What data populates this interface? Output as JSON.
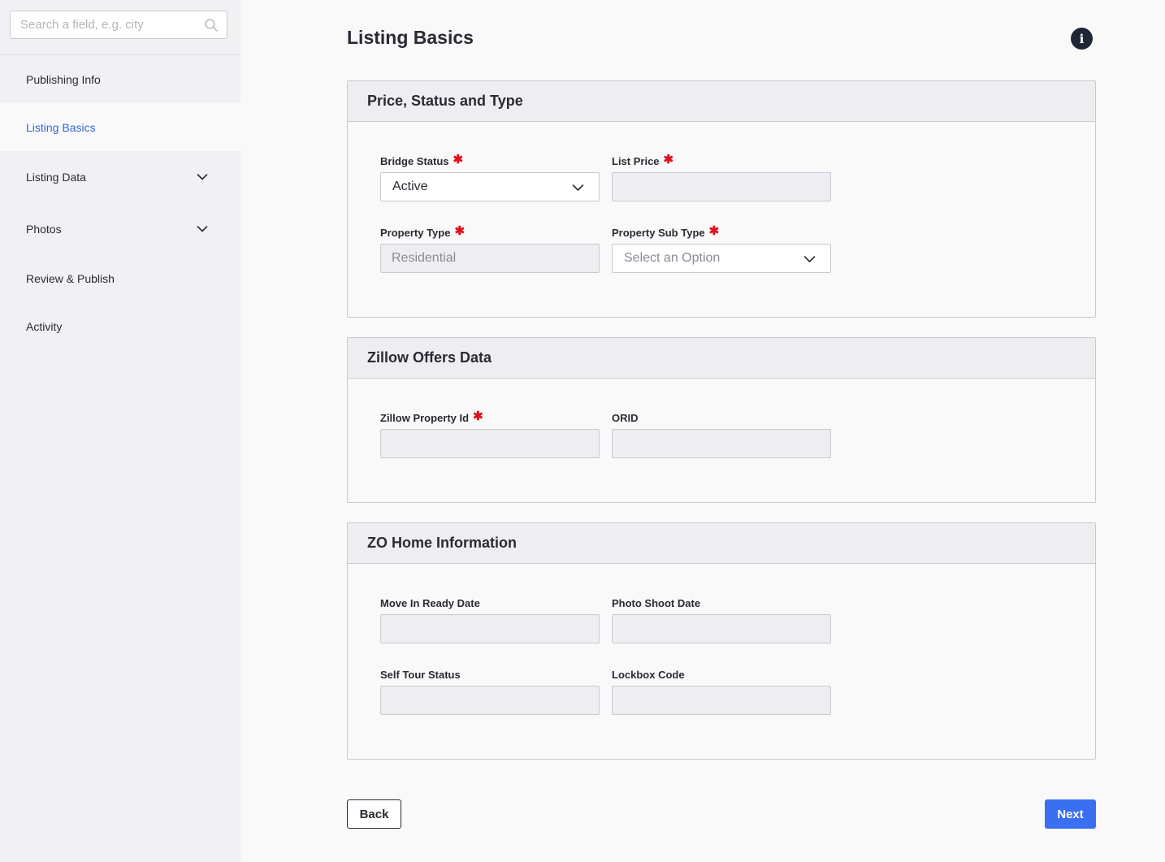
{
  "sidebar": {
    "search_placeholder": "Search a field, e.g. city",
    "items": [
      {
        "label": "Publishing Info"
      },
      {
        "label": "Listing Basics"
      },
      {
        "label": "Listing Data"
      },
      {
        "label": "Photos"
      },
      {
        "label": "Review & Publish"
      },
      {
        "label": "Activity"
      }
    ],
    "active_item": "Listing Basics"
  },
  "page": {
    "title": "Listing Basics",
    "info_icon": "i"
  },
  "sections": {
    "price": {
      "title": "Price, Status and Type",
      "bridge_status": {
        "label": "Bridge Status",
        "value": "Active",
        "required": "✱"
      },
      "list_price": {
        "label": "List Price",
        "value": "",
        "required": "✱"
      },
      "property_type": {
        "label": "Property Type",
        "value": "Residential",
        "required": "✱"
      },
      "property_sub_type": {
        "label": "Property Sub Type",
        "placeholder": "Select an Option",
        "required": "✱"
      }
    },
    "zillow": {
      "title": "Zillow Offers Data",
      "zillow_property_id": {
        "label": "Zillow Property Id",
        "value": "",
        "required": "✱"
      },
      "orid": {
        "label": "ORID",
        "value": ""
      }
    },
    "zo_home": {
      "title": "ZO Home Information",
      "move_in_ready_date": {
        "label": "Move In Ready Date",
        "value": ""
      },
      "photo_shoot_date": {
        "label": "Photo Shoot Date",
        "value": ""
      },
      "self_tour_status": {
        "label": "Self Tour Status",
        "value": ""
      },
      "lockbox_code": {
        "label": "Lockbox Code",
        "value": ""
      }
    }
  },
  "footer": {
    "back_label": "Back",
    "next_label": "Next"
  },
  "colors": {
    "accent": "#3a6ff2",
    "active_nav": "#3466d6",
    "required": "#e0101b"
  }
}
